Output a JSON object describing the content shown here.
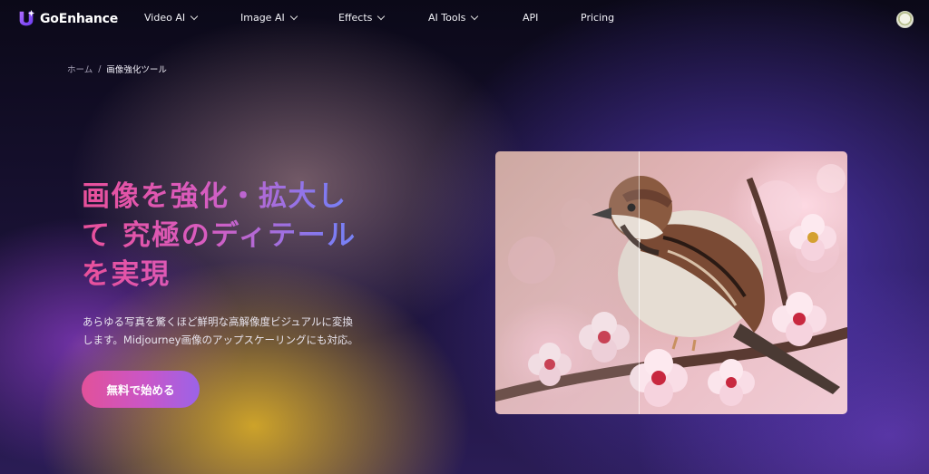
{
  "brand": {
    "name": "GoEnhance",
    "accent": "#8b3fe0"
  },
  "nav": {
    "items": [
      {
        "label": "Video AI",
        "has_dropdown": true
      },
      {
        "label": "Image AI",
        "has_dropdown": true
      },
      {
        "label": "Effects",
        "has_dropdown": true
      },
      {
        "label": "AI Tools",
        "has_dropdown": true
      },
      {
        "label": "API",
        "has_dropdown": false
      },
      {
        "label": "Pricing",
        "has_dropdown": false
      }
    ]
  },
  "breadcrumb": {
    "home": "ホーム",
    "separator": "/",
    "current": "画像強化ツール"
  },
  "hero": {
    "title_lines": [
      "画像を強化・拡大し",
      "て 究極のディテール",
      "を実現"
    ],
    "description_lines": [
      "あらゆる写真を驚くほど鮮明な高解像度ビジュアルに変換",
      "します。Midjourney画像のアップスケーリングにも対応。"
    ],
    "cta_label": "無料で始める"
  },
  "compare_image": {
    "icon": "sparrow-on-cherry-blossom-image"
  },
  "icons": {
    "logo": "goenhance-logo-icon",
    "dropdown": "chevron-down-icon",
    "avatar": "avatar"
  }
}
